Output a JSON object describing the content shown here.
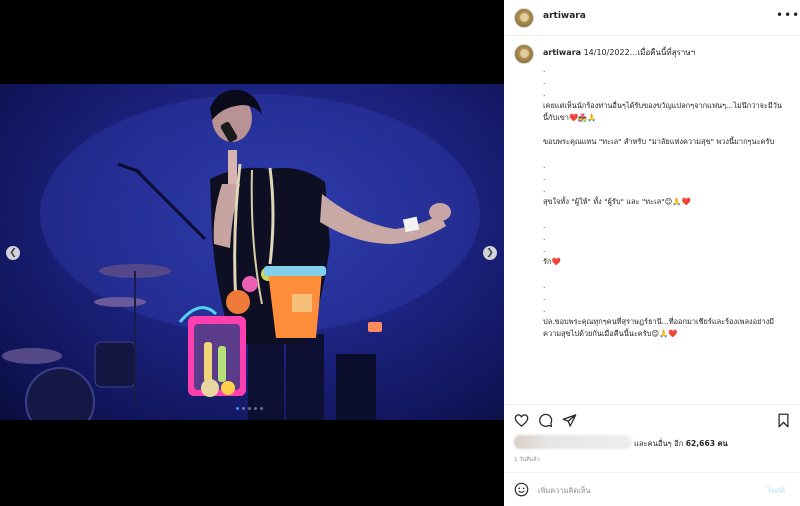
{
  "post": {
    "username": "artiwara",
    "more_label": "•••"
  },
  "caption": {
    "username": "artiwara",
    "headline": "14/10/2022...เมื่อคืนนี้ที่สุราษฯ",
    "lines": [
      ".",
      ".",
      ".",
      "เคยแต่เห็นนักร้องท่านอื่นๆได้รับของขวัญแปลกๆจากแฟนๆ...ไม่นึกว่าจะมีวันนี้กับเขา❤️👩‍❤️‍👨🙏",
      "",
      "ขอบพระคุณแทน \"ทะเล\" สำหรับ \"มาลัยแห่งความสุข\" พวงนี้มากๆนะครับ",
      "",
      ".",
      ".",
      ".",
      "สุขใจทั้ง \"ผู้ให้\" ทั้ง \"ผู้รับ\" และ \"ทะเล\"😊🙏❤️",
      "",
      ".",
      ".",
      ".",
      "รัก❤️",
      "",
      ".",
      ".",
      ".",
      "ปล.ขอบพระคุณทุกๆคนที่สุราษฎร์ธานี...ที่ออกมาเชียร์และร้องเพลงอย่างมีความสุขไปด้วยกันเมื่อคืนนี้นะครับ😊🙏❤️"
    ]
  },
  "likes": {
    "prefix": "และคนอื่นๆ อีก",
    "count": "62,663",
    "suffix": "คน"
  },
  "timestamp": "1 วันที่แล้ว",
  "comment": {
    "placeholder": "เพิ่มความคิดเห็น",
    "post_label": "โพสต์"
  },
  "carousel": {
    "prev_icon": "chevron-left-icon",
    "next_icon": "chevron-right-icon",
    "slide_count": 5,
    "active_slide": 1
  },
  "colors": {
    "accent": "#0095f6",
    "post_disabled": "#b2dffc",
    "stage_blue": "#1c2380"
  }
}
